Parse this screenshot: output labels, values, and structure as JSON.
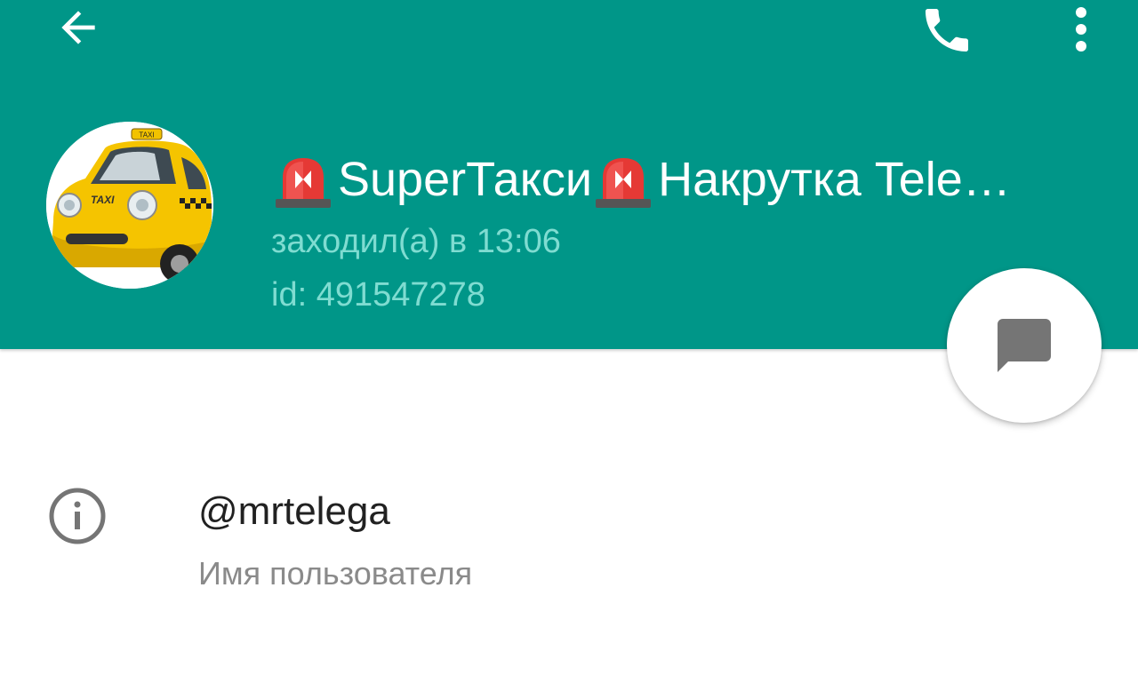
{
  "header": {
    "title_parts": [
      "SuperТакси",
      "Накрутка Tele…"
    ],
    "title_emoji": "police-car-light",
    "status": "заходил(а) в 13:06",
    "user_id": "id: 491547278",
    "background_color": "#009688",
    "avatar_icon": "yellow-taxi-avatar",
    "avatar_badge": "TAXI"
  },
  "toolbar": {
    "back_icon": "arrow-back-icon",
    "call_icon": "phone-icon",
    "more_icon": "more-vertical-icon"
  },
  "fab": {
    "icon": "message-icon"
  },
  "info": {
    "icon": "info-icon",
    "username": "@mrtelega",
    "username_label": "Имя пользователя"
  }
}
